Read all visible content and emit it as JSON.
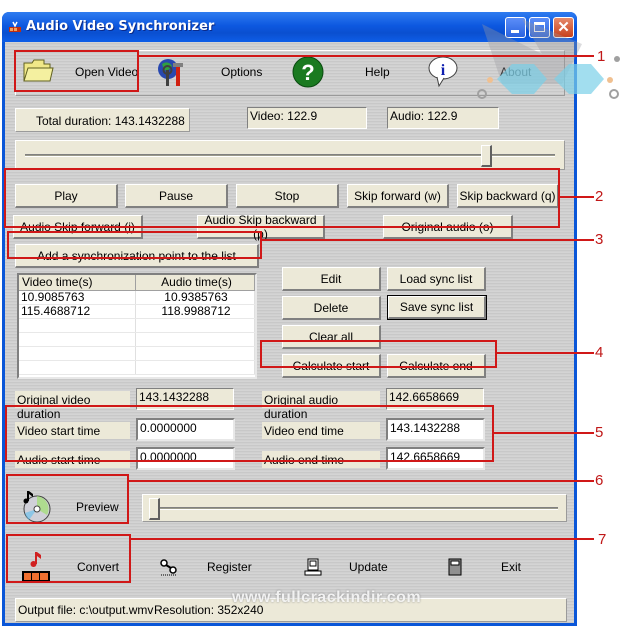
{
  "window": {
    "title": "Audio Video Synchronizer",
    "controls": {
      "minimize": "minimize",
      "maximize": "maximize",
      "close": "✕"
    }
  },
  "toolbar": {
    "items": [
      {
        "label": "Open Video",
        "icon": "folder-icon"
      },
      {
        "label": "Options",
        "icon": "globe-tools-icon"
      },
      {
        "label": "Help",
        "icon": "question-icon"
      },
      {
        "label": "About",
        "icon": "info-icon"
      }
    ]
  },
  "status": {
    "total_duration": "Total duration: 143.1432288",
    "video": "Video: 122.9",
    "audio": "Audio: 122.9"
  },
  "main_slider": {
    "position_fraction": 0.87
  },
  "playback_buttons": [
    "Play",
    "Pause",
    "Stop",
    "Skip  forward (w)",
    "Skip backward (q)"
  ],
  "audio_buttons": [
    "Audio Skip forward (i)",
    "Audio Skip backward (p)",
    "Original audio (o)"
  ],
  "add_sync_point": "Add a synchronization point to the list",
  "sync_list": {
    "columns": [
      "Video time(s)",
      "Audio time(s)"
    ],
    "rows": [
      [
        "10.9085763",
        "10.9385763"
      ],
      [
        "115.4688712",
        "118.9988712"
      ]
    ]
  },
  "list_actions": {
    "edit": "Edit",
    "load": "Load sync list",
    "delete": "Delete",
    "save": "Save sync list",
    "clear": "Clear all",
    "calc_start": "Calculate start",
    "calc_end": "Calculate end"
  },
  "durations": {
    "video_label": "Original video duration",
    "video_value": "143.1432288",
    "audio_label": "Original audio duration",
    "audio_value": "142.6658669"
  },
  "times": {
    "video_start_label": "Video start time",
    "video_start": "0.0000000",
    "audio_start_label": "Audio start time",
    "audio_start": "0.0000000",
    "video_end_label": "Video end time",
    "video_end": "143.1432288",
    "audio_end_label": "Audio end time",
    "audio_end": "142.6658669"
  },
  "preview": {
    "label": "Preview",
    "slider_fraction": 0.0
  },
  "bottom_toolbar": {
    "items": [
      {
        "label": "Convert",
        "icon": "film-music-icon"
      },
      {
        "label": "Register",
        "icon": "key-icon"
      },
      {
        "label": "Update",
        "icon": "computer-icon"
      },
      {
        "label": "Exit",
        "icon": "door-icon"
      }
    ]
  },
  "statusbar": {
    "output_file": "Output file: c:\\output.wmv",
    "resolution": "Resolution: 352x240"
  },
  "annotations": [
    "1",
    "2",
    "3",
    "4",
    "5",
    "6",
    "7"
  ],
  "watermark": "www.fullcrackindir.com",
  "colors": {
    "callout_red": "#d01818",
    "titlebar_blue": "#0a56d8",
    "control_beige": "#ece9d8"
  }
}
